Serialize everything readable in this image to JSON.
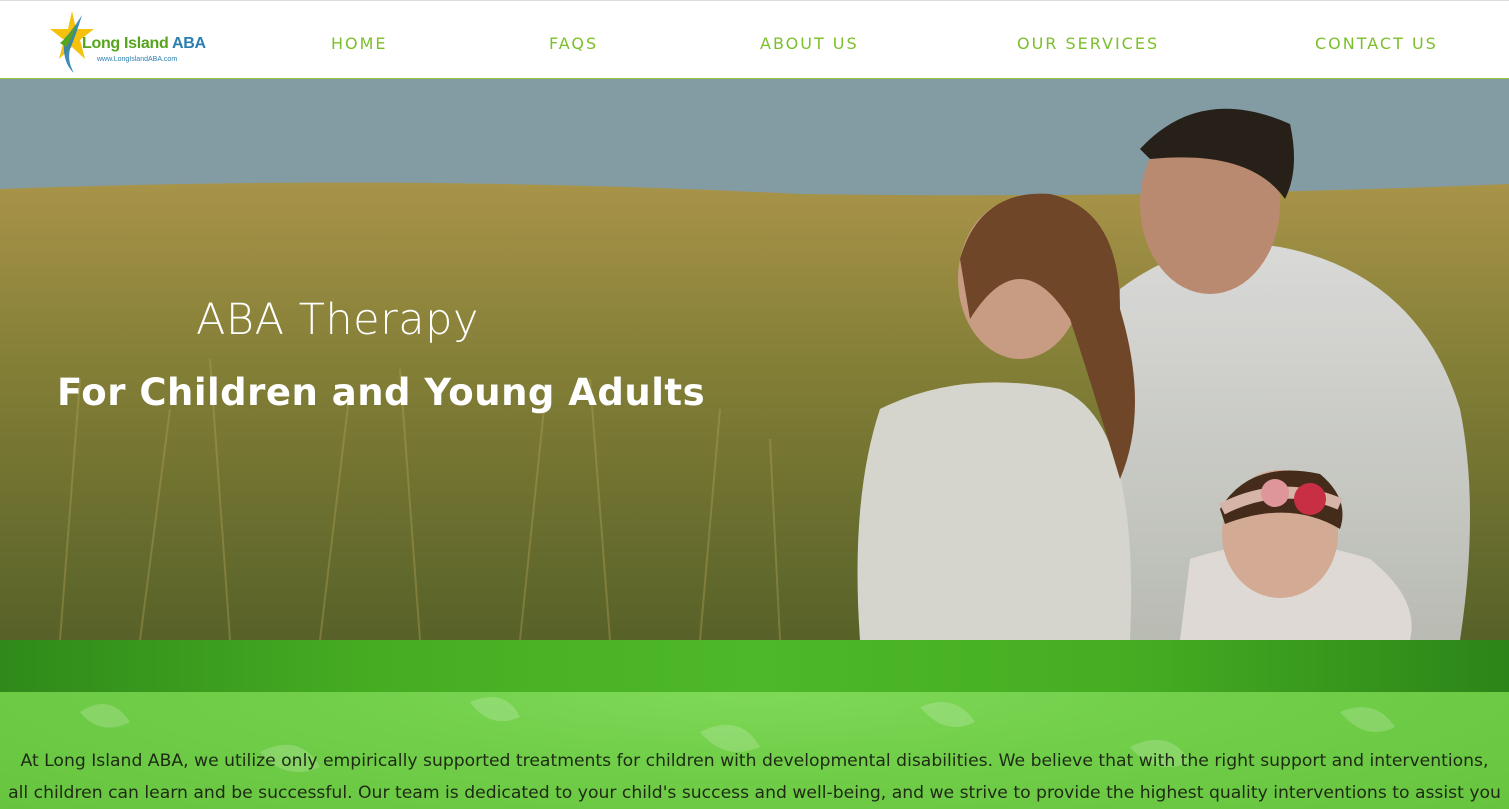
{
  "header": {
    "logo": {
      "name_main": "Long Island ",
      "name_accent": "ABA",
      "url": "www.LongIslandABA.com",
      "colors": {
        "green": "#55a51c",
        "blue": "#2a7fb0",
        "star_yellow": "#f4c20d"
      }
    },
    "nav": [
      {
        "label": "HOME"
      },
      {
        "label": "FAQS"
      },
      {
        "label": "ABOUT US"
      },
      {
        "label": "OUR SERVICES"
      },
      {
        "label": "CONTACT US"
      }
    ],
    "nav_color": "#7cbf2a"
  },
  "hero": {
    "title": "ABA Therapy",
    "subtitle": "For Children and Young Adults",
    "image_description_icon": "family-photo"
  },
  "intro": {
    "text": "At Long Island ABA, we utilize only empirically supported treatments for children with developmental disabilities. We believe that with the right support and interventions, all children can learn and be successful. Our team is dedicated to your child's success and well-being, and we strive to provide the highest quality interventions to assist you and"
  },
  "colors": {
    "band_green": "#4db829",
    "intro_green": "#72cf4a"
  }
}
